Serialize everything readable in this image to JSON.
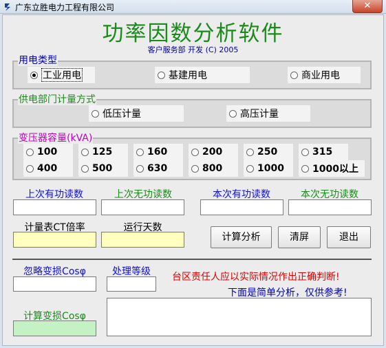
{
  "window": {
    "title": "广东立胜电力工程有限公司",
    "close": "✕"
  },
  "header": {
    "title": "功率因数分析软件",
    "subtitle": "客户服务部 开发 (C) 2005"
  },
  "usage_type": {
    "legend": "用电类型",
    "options": [
      "工业用电",
      "基建用电",
      "商业用电"
    ],
    "selected": "工业用电"
  },
  "metering": {
    "legend": "供电部门计量方式",
    "options": [
      "低压计量",
      "高压计量"
    ]
  },
  "capacity": {
    "legend": "变压器容量(kVA)",
    "options": [
      "100",
      "125",
      "160",
      "200",
      "250",
      "315",
      "400",
      "500",
      "630",
      "800",
      "1000",
      "1000以上"
    ]
  },
  "readings": {
    "last_active": "上次有功读数",
    "last_reactive": "上次无功读数",
    "cur_active": "本次有功读数",
    "cur_reactive": "本次无功读数"
  },
  "params": {
    "ct_ratio": "计量表CT倍率",
    "run_days": "运行天数"
  },
  "buttons": {
    "calc": "计算分析",
    "clear": "清屏",
    "exit": "退出"
  },
  "loss": {
    "ignore_cos": "忽略变损Cosφ",
    "level": "处理等级",
    "calc_cos": "计算变损Cosφ"
  },
  "notes": {
    "warning": "台区责任人应以实际情况作出正确判断!",
    "hint": "下面是简单分析，仅供参考!"
  },
  "colors": {
    "title_green": "#1a8a1a",
    "reading_blue": "#1010e0",
    "reading_green": "#1a8a1a",
    "warning_red": "#e00000",
    "hint_blue": "#0000c0",
    "legend_magenta": "#c000c0",
    "legend_blue": "#0000c0",
    "legend_green": "#1a8a1a"
  }
}
